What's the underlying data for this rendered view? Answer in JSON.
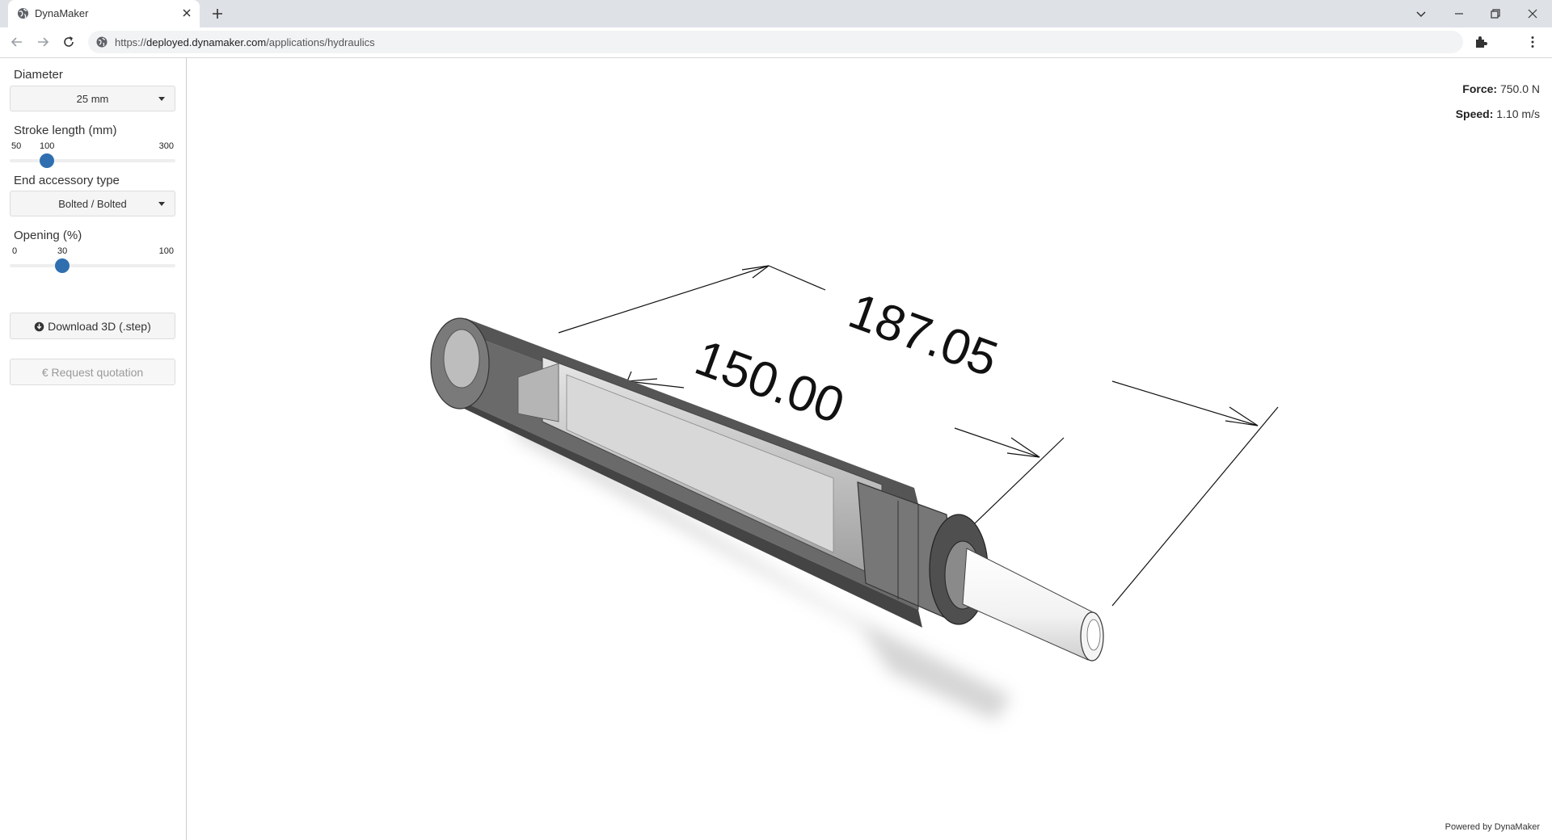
{
  "browser": {
    "tab_title": "DynaMaker",
    "url_prefix": "https://",
    "url_host": "deployed.dynamaker.com",
    "url_path": "/applications/hydraulics"
  },
  "sidebar": {
    "diameter": {
      "label": "Diameter",
      "value": "25 mm"
    },
    "stroke": {
      "label": "Stroke length (mm)",
      "min": "50",
      "value": "100",
      "max": "300",
      "fraction": 0.2
    },
    "accessory": {
      "label": "End accessory type",
      "value": "Bolted / Bolted"
    },
    "opening": {
      "label": "Opening (%)",
      "min": "0",
      "value": "30",
      "max": "100",
      "fraction": 0.3
    },
    "download_label": "Download 3D (.step)",
    "quote_label": "Request quotation"
  },
  "viewer": {
    "force_label": "Force:",
    "force_value": "750.0 N",
    "speed_label": "Speed:",
    "speed_value": "1.10 m/s",
    "dim_outer": "187.05",
    "dim_inner": "150.00",
    "powered_by": "Powered by DynaMaker"
  },
  "icons": [
    "globe-icon",
    "close-icon",
    "plus-icon",
    "back-icon",
    "forward-icon",
    "reload-icon",
    "site-info-icon",
    "puzzle-icon",
    "kebab-menu-icon",
    "download-icon",
    "euro-icon"
  ]
}
